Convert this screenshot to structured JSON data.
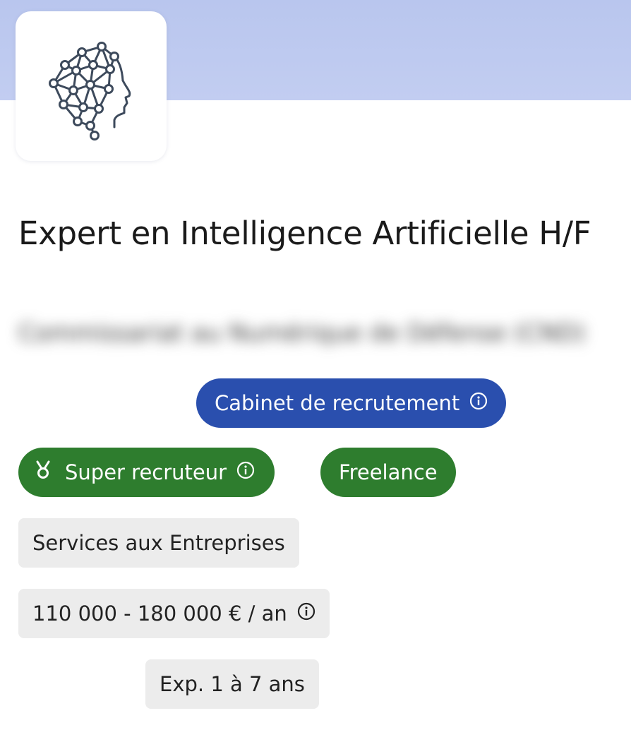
{
  "job": {
    "title": "Expert en Intelligence Artificielle H/F",
    "company": "Commissariat au Numérique de Défense (CND)",
    "logo_icon": "ai-brain-head-icon"
  },
  "tags": {
    "recruiter_type": "Cabinet de recrutement",
    "super_recruiter": "Super recruteur",
    "contract": "Freelance",
    "sector": "Services aux Entreprises",
    "salary": "110 000 - 180 000 € / an",
    "experience": "Exp. 1 à 7 ans"
  },
  "colors": {
    "banner": "#b9c6ee",
    "pill_blue": "#2a4fae",
    "pill_green": "#2e7d2e",
    "chip_gray": "#ececec"
  }
}
